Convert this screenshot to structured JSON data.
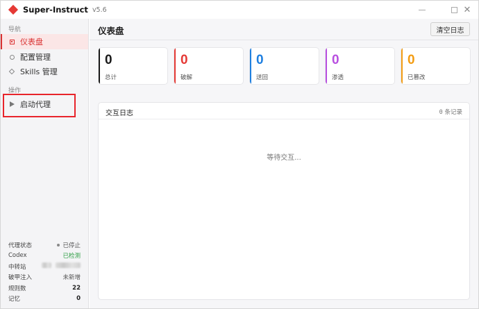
{
  "app": {
    "title": "Super-Instruct",
    "version": "v5.6"
  },
  "window_controls": {
    "close_glyph": "✕"
  },
  "sidebar": {
    "nav_section": "导航",
    "items": [
      {
        "label": "仪表盘",
        "icon": "dashboard-icon",
        "active": true
      },
      {
        "label": "配置管理",
        "icon": "settings-ring-icon",
        "active": false
      },
      {
        "label": "Skills 管理",
        "icon": "diamond-icon",
        "active": false
      }
    ],
    "ops_section": "操作",
    "proxy_button": {
      "label": "启动代理",
      "icon": "play-icon"
    },
    "status": [
      {
        "label": "代理状态",
        "value": "已停止",
        "style": "dot"
      },
      {
        "label": "Codex",
        "value": "已检测",
        "style": "ok"
      },
      {
        "label": "中转站",
        "value": "",
        "style": "redacted"
      },
      {
        "label": "破甲注入",
        "value": "未新增",
        "style": "plain"
      },
      {
        "label": "规则数",
        "value": "22",
        "style": "bold"
      },
      {
        "label": "记忆",
        "value": "0",
        "style": "bold"
      }
    ]
  },
  "main": {
    "title": "仪表盘",
    "clear_button": "清空日志",
    "stats": [
      {
        "value": "0",
        "label": "总计",
        "color": "#1a1a1a"
      },
      {
        "value": "0",
        "label": "破解",
        "color": "#e53935"
      },
      {
        "value": "0",
        "label": "送回",
        "color": "#1e7fe0"
      },
      {
        "value": "0",
        "label": "渗透",
        "color": "#b84fe0"
      },
      {
        "value": "0",
        "label": "已篡改",
        "color": "#f39c12"
      }
    ],
    "log": {
      "title": "交互日志",
      "count": "0",
      "count_suffix": "条记录",
      "empty_text": "等待交互..."
    }
  }
}
